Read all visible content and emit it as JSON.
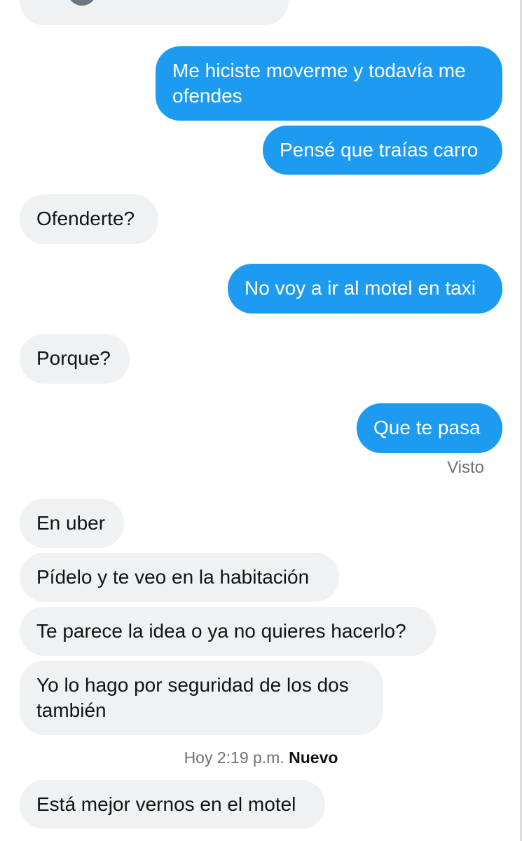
{
  "conversation": {
    "messages": [
      {
        "direction": "sent",
        "text": "Me hiciste moverme y todavía me ofendes"
      },
      {
        "direction": "sent",
        "text": "Pensé que traías carro"
      },
      {
        "direction": "received",
        "text": "Ofenderte?"
      },
      {
        "direction": "sent",
        "text": "No voy a ir al motel en taxi"
      },
      {
        "direction": "received",
        "text": "Porque?"
      },
      {
        "direction": "sent",
        "text": "Que te pasa"
      },
      {
        "direction": "received",
        "text": "En uber"
      },
      {
        "direction": "received",
        "text": "Pídelo y te veo en la habitación"
      },
      {
        "direction": "received",
        "text": "Te parece la idea o ya no quieres hacerlo?"
      },
      {
        "direction": "received",
        "text": "Yo lo hago por seguridad de los dos también"
      },
      {
        "direction": "received",
        "text": "Está mejor vernos en el motel"
      }
    ],
    "read_receipt": "Visto",
    "timestamp": {
      "time": "Hoy 2:19 p.m.",
      "new_label": "Nuevo"
    }
  },
  "colors": {
    "sent_bubble": "#1d9bf0",
    "received_bubble": "#eff1f2",
    "background": "#ffffff",
    "muted_text": "#6b7276"
  }
}
